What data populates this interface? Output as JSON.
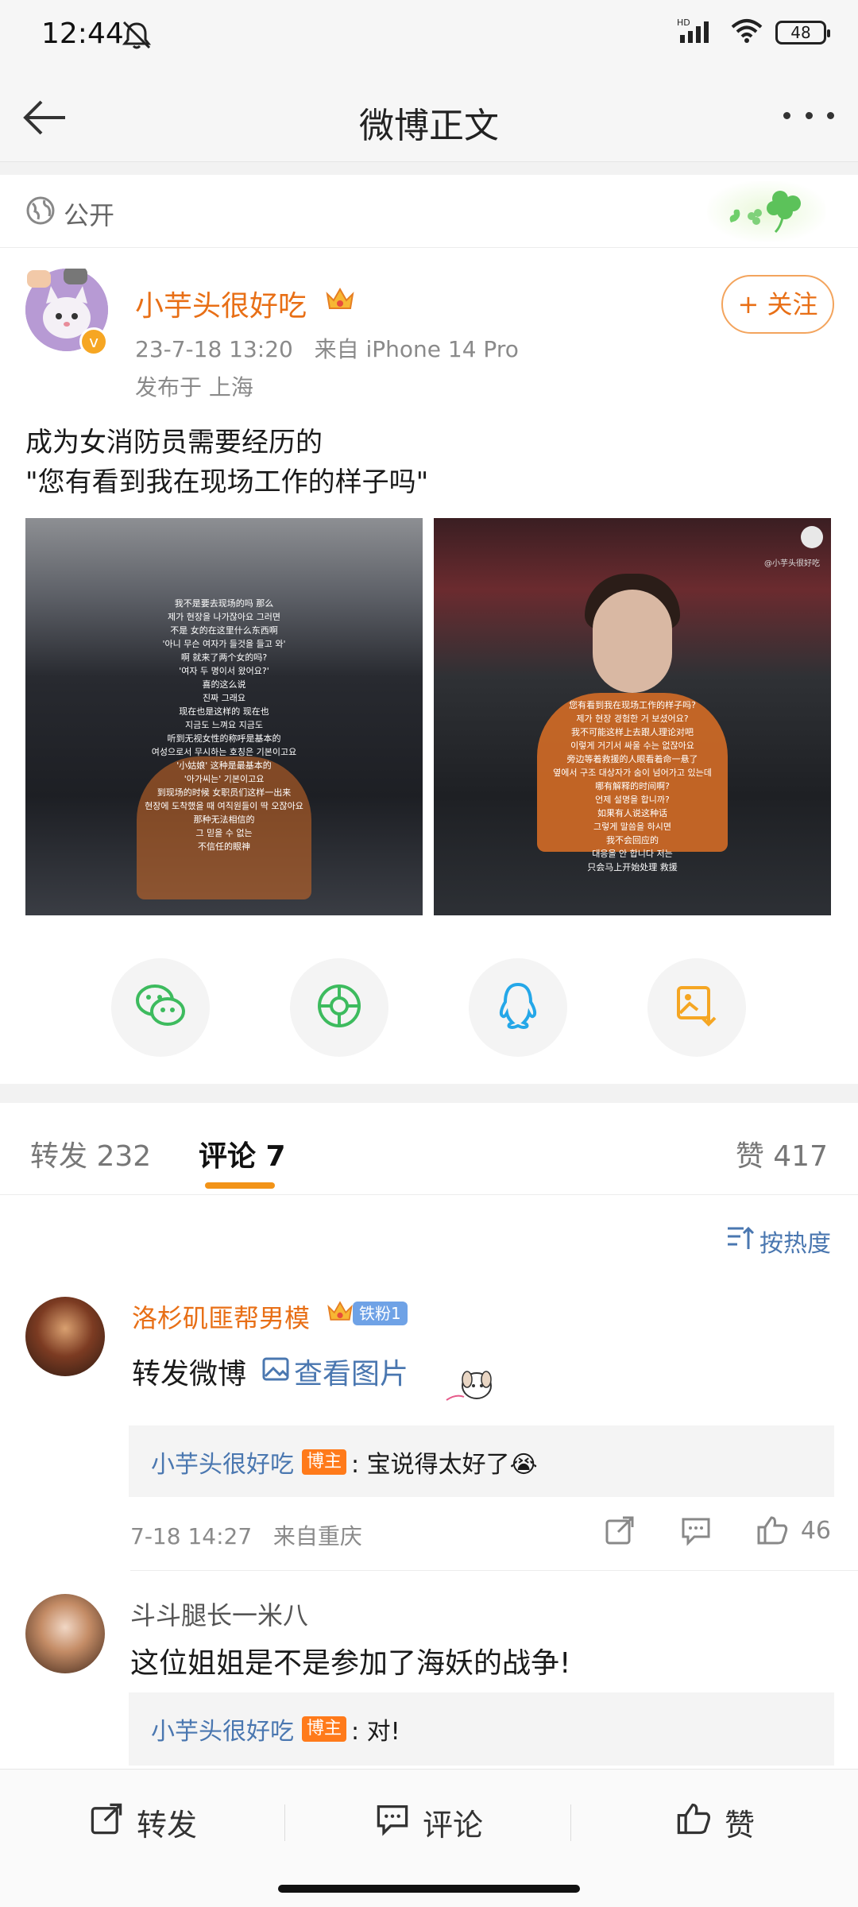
{
  "status_bar": {
    "time": "12:44",
    "battery": "48",
    "network": "HD"
  },
  "nav": {
    "title": "微博正文"
  },
  "visibility": {
    "label": "公开"
  },
  "post": {
    "author": "小芋头很好吃",
    "timestamp": "23-7-18 13:20",
    "source": "来自 iPhone 14 Pro",
    "location": "发布于 上海",
    "follow_label": "+ 关注",
    "text_line1": "成为女消防员需要经历的",
    "text_line2": "\"您有看到我在现场工作的样子吗\"",
    "image1_subtitles": [
      "我不是要去现场的吗 那么",
      "제가 현장을 나가잖아요 그러면",
      "不是 女的在这里什么东西啊",
      "'아니 무슨 여자가 들것을 들고 와'",
      "啊 就来了两个女的吗?",
      "'여자 두 명이서 왔어요?'",
      "喜的这么说",
      "진짜 그래요",
      "现在也是这样的 现在也",
      "지금도 느껴요 지금도",
      "听到无视女性的称呼是基本的",
      "여성으로서 무시하는 호칭은 기본이고요",
      "'小姑娘' 这种是最基本的",
      "'아가씨는' 기본이고요",
      "到现场的时候 女职员们这样一出来",
      "현장에 도착했을 때 여직원들이 딱 오잖아요",
      "那种无法相信的",
      "그 믿을 수 없는",
      "不信任的眼神"
    ],
    "image2_watermark": "@小芋头很好吃",
    "image2_subtitles": [
      "您有看到我在现场工作的样子吗?",
      "제가 현장 경험한 거 보셨어요?",
      "我不可能这样上去跟人理论对吧",
      "이렇게 거기서 싸울 수는 없잖아요",
      "旁边等着救援的人眼看着命一悬了",
      "옆에서 구조 대상자가 숨이 넘어가고 있는데",
      "哪有解释的时间啊?",
      "언제 설명을 합니까?",
      "如果有人说这种话",
      "그렇게 말씀을 하시면",
      "我不会回应的",
      "대응을 안 합니다 저는",
      "只会马上开始处理 救援"
    ]
  },
  "share_targets": [
    {
      "name": "wechat",
      "icon": "wechat-icon",
      "color": "#3dbb5e"
    },
    {
      "name": "moments",
      "icon": "moments-icon",
      "color": "#3dbb5e"
    },
    {
      "name": "qq",
      "icon": "qq-icon",
      "color": "#24a7e8"
    },
    {
      "name": "save-image",
      "icon": "save-image-icon",
      "color": "#f5a623"
    }
  ],
  "tabs": {
    "repost": "转发 232",
    "comment": "评论 7",
    "like": "赞 417"
  },
  "sort": {
    "label": "按热度"
  },
  "comments": [
    {
      "author": "洛杉矶匪帮男模",
      "fan_badge": "铁粉1",
      "text": "转发微博",
      "link_text": "查看图片",
      "reply_author": "小芋头很好吃",
      "reply_badge": "博主",
      "reply_text": ": 宝说得太好了😭",
      "time": "7-18 14:27",
      "location": "来自重庆",
      "likes": "46"
    },
    {
      "author": "斗斗腿长一米八",
      "text": "这位姐姐是不是参加了海妖的战争!",
      "reply_author": "小芋头很好吃",
      "reply_badge": "博主",
      "reply_text": ": 对!"
    }
  ],
  "bottom_bar": {
    "repost": "转发",
    "comment": "评论",
    "like": "赞"
  },
  "colors": {
    "accent": "#e86f16",
    "link": "#4a77b0",
    "tab_underline": "#f29318",
    "host_badge": "#ff7a1a"
  }
}
